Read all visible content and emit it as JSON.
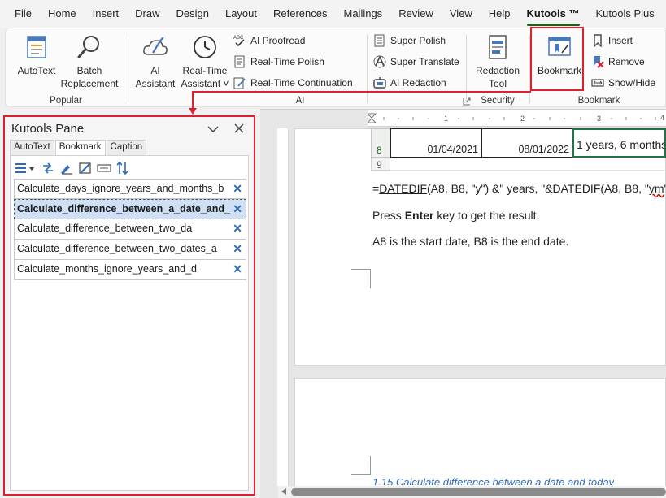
{
  "menu": {
    "tabs": [
      "File",
      "Home",
      "Insert",
      "Draw",
      "Design",
      "Layout",
      "References",
      "Mailings",
      "Review",
      "View",
      "Help",
      "Kutools ™",
      "Kutools Plus"
    ],
    "active": "Kutools ™"
  },
  "ribbon": {
    "popular": {
      "label": "Popular",
      "autotext": "AutoText",
      "batch_line1": "Batch",
      "batch_line2": "Replacement"
    },
    "ai": {
      "label": "AI",
      "assistant_line1": "AI",
      "assistant_line2": "Assistant",
      "rt_assistant_line1": "Real-Time",
      "rt_assistant_line2": "Assistant ˅",
      "proofread": "AI Proofread",
      "rt_polish": "Real-Time Polish",
      "rt_continuation": "Real-Time Continuation",
      "super_polish": "Super Polish",
      "super_translate": "Super Translate",
      "ai_redaction": "AI Redaction",
      "abc": "ABC"
    },
    "security": {
      "label": "Security",
      "redaction_line1": "Redaction",
      "redaction_line2": "Tool"
    },
    "bookmark": {
      "label": "Bookmark",
      "bookmark": "Bookmark",
      "insert": "Insert",
      "remove": "Remove",
      "showhide": "Show/Hide"
    },
    "colors": {
      "highlight": "#e0202a",
      "accent": "#1b5e20"
    }
  },
  "pane": {
    "title": "Kutools Pane",
    "tabs": [
      "AutoText",
      "Bookmark",
      "Caption"
    ],
    "active_tab": "Bookmark",
    "bookmarks": [
      {
        "name": "Calculate_days_ignore_years_and_months_b",
        "selected": false
      },
      {
        "name": "Calculate_difference_between_a_date_and_",
        "selected": true
      },
      {
        "name": "Calculate_difference_between_two_da",
        "selected": false
      },
      {
        "name": "Calculate_difference_between_two_dates_a",
        "selected": false
      },
      {
        "name": "Calculate_months_ignore_years_and_d",
        "selected": false
      }
    ],
    "remove_glyph": "✕"
  },
  "ruler": {
    "marks": [
      "1",
      "2",
      "3",
      "4"
    ]
  },
  "document": {
    "row_numbers": [
      "8",
      "9"
    ],
    "cells": [
      "01/04/2021",
      "08/01/2022",
      "1 years, 6 months"
    ],
    "formula_prefix": "=",
    "formula_fn": "DATEDIF",
    "formula_mid": "(A8, B8, \"y\") &\" years, \"&DATEDIF(A8, B8, \"",
    "formula_ym": "ym",
    "formula_end": "\")",
    "press": "Press ",
    "enter": "Enter",
    "press_rest": " key to get the result.",
    "explain": "A8 is the start date, B8 is the end date.",
    "next_heading": "1.15 Calculate difference between a date and today"
  }
}
